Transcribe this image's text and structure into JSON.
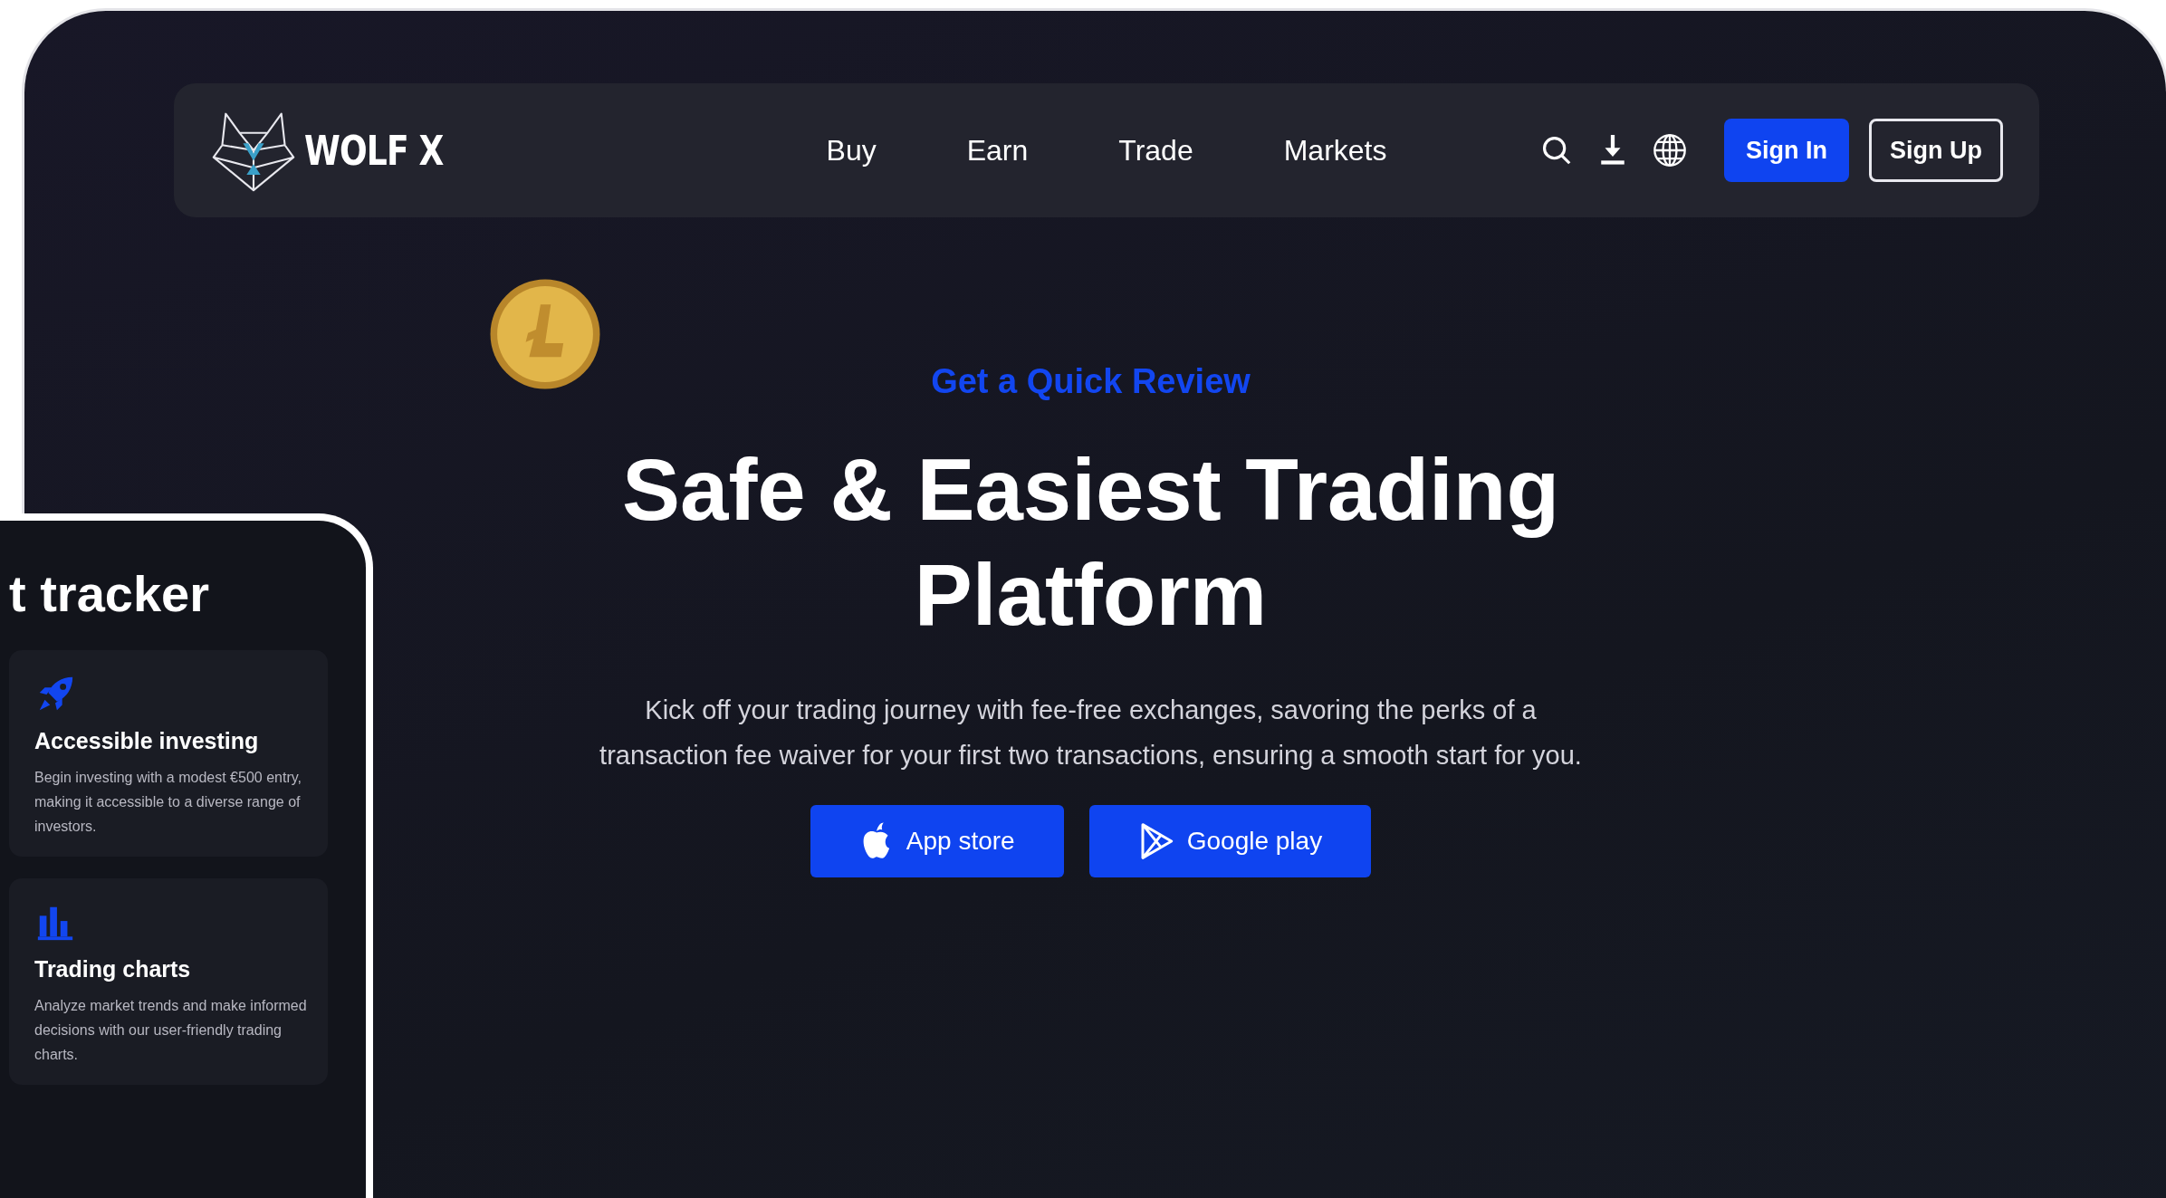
{
  "brand": {
    "name": "WOLF X"
  },
  "nav": {
    "links": [
      {
        "label": "Buy"
      },
      {
        "label": "Earn"
      },
      {
        "label": "Trade"
      },
      {
        "label": "Markets"
      }
    ],
    "sign_in": "Sign In",
    "sign_up": "Sign Up"
  },
  "hero": {
    "eyebrow": "Get a Quick Review",
    "title": "Safe & Easiest Trading Platform",
    "description": "Kick off your trading journey with fee-free exchanges, savoring the perks of a transaction fee waiver for your first two transactions, ensuring a smooth start for you.",
    "buttons": [
      {
        "kind": "apple",
        "label": "App store"
      },
      {
        "kind": "play",
        "label": "Google play"
      }
    ]
  },
  "side_panel": {
    "heading": "t tracker",
    "features": [
      {
        "kind": "rocket",
        "title": "Accessible investing",
        "description": "Begin investing with a modest €500 entry, making it accessible to a diverse range of investors."
      },
      {
        "kind": "chart",
        "title": "Trading charts",
        "description": "Analyze market trends and make informed decisions with our user-friendly trading charts."
      }
    ]
  }
}
